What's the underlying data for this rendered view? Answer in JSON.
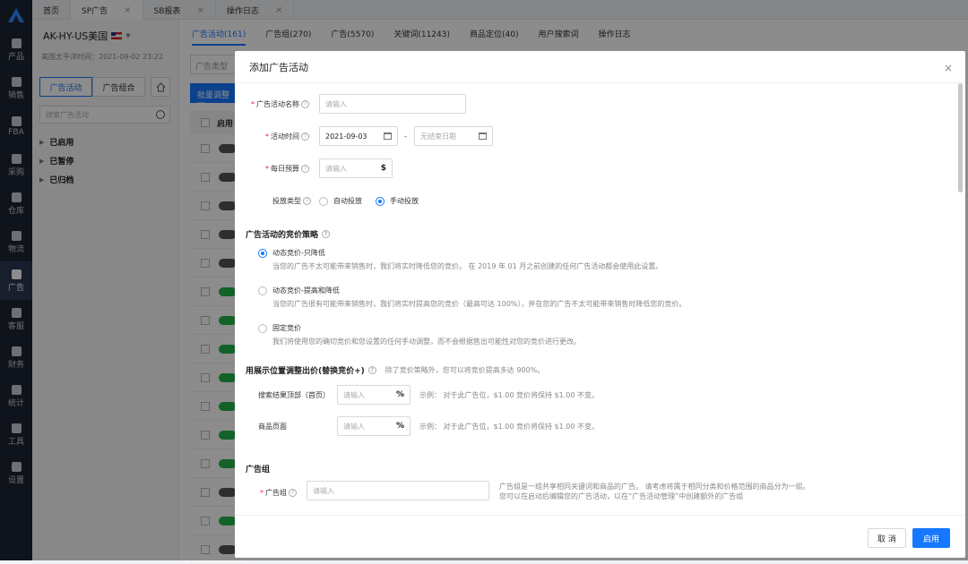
{
  "nav": [
    {
      "label": "产品",
      "icon": "product-icon"
    },
    {
      "label": "销售",
      "icon": "sales-icon"
    },
    {
      "label": "FBA",
      "icon": "fba-icon"
    },
    {
      "label": "采购",
      "icon": "cart-icon"
    },
    {
      "label": "仓库",
      "icon": "warehouse-icon"
    },
    {
      "label": "物流",
      "icon": "truck-icon"
    },
    {
      "label": "广告",
      "icon": "ad-icon"
    },
    {
      "label": "客服",
      "icon": "mail-icon"
    },
    {
      "label": "财务",
      "icon": "finance-icon"
    },
    {
      "label": "统计",
      "icon": "pie-icon"
    },
    {
      "label": "工具",
      "icon": "tool-icon"
    },
    {
      "label": "设置",
      "icon": "gear-icon"
    }
  ],
  "tabs": [
    {
      "label": "首页"
    },
    {
      "label": "SP广告",
      "close": "×"
    },
    {
      "label": "SB报表",
      "close": "×"
    },
    {
      "label": "操作日志",
      "close": "×"
    }
  ],
  "side": {
    "store": "AK-HY-US美国",
    "timezone": "美国太平洋时间：2021-09-02 23:22",
    "seg1": "广告活动",
    "seg2": "广告组合",
    "search_placeholder": "搜索广告活动",
    "tree": [
      "已启用",
      "已暂停",
      "已归档"
    ]
  },
  "main": {
    "tabs": [
      "广告活动(161)",
      "广告组(270)",
      "广告(5570)",
      "关键词(11243)",
      "商品定位(40)",
      "用户搜索词",
      "操作日志"
    ],
    "filter": "广告类型",
    "batch": "批量调整预",
    "col": "启用"
  },
  "modal": {
    "title": "添加广告活动",
    "close": "×",
    "name_label": "广告活动名称",
    "name_placeholder": "请输入",
    "time_label": "活动时间",
    "start_date": "2021-09-03",
    "date_sep": "-",
    "end_placeholder": "无结束日期",
    "budget_label": "每日预算",
    "budget_placeholder": "请输入",
    "budget_suffix": "$",
    "type_label": "投放类型",
    "type_auto": "自动投放",
    "type_manual": "手动投放",
    "bid_section": "广告活动的竞价策略",
    "bid_opts": [
      {
        "title": "动态竞价-只降低",
        "desc": "当您的广告不太可能带来销售时，我们将实时降低您的竞价。 在 2019 年 01 月之前创建的任何广告活动都会使用此设置。",
        "selected": true
      },
      {
        "title": "动态竞价-提高和降低",
        "desc": "当您的广告很有可能带来销售时，我们将实时提高您的竞价（最高可达 100%），并在您的广告不太可能带来销售时降低您的竞价。",
        "selected": false
      },
      {
        "title": "固定竞价",
        "desc": "我们将使用您的确切竞价和您设置的任何手动调整，而不会根据售出可能性对您的竞价进行更改。",
        "selected": false
      }
    ],
    "place_section": "用展示位置调整出价(替换竞价+)",
    "place_hint": "除了竞价策略外，您可以将竞价提高多达 900%。",
    "place_rows": [
      {
        "label": "搜索结果顶部（首页）",
        "placeholder": "请输入",
        "suffix": "%",
        "example": "示例： 对于此广告位，$1.00 竞价将保持 $1.00 不变。"
      },
      {
        "label": "商品页面",
        "placeholder": "请输入",
        "suffix": "%",
        "example": "示例： 对于此广告位，$1.00 竞价将保持 $1.00 不变。"
      }
    ],
    "group_section": "广告组",
    "group_label": "广告组",
    "group_placeholder": "请输入",
    "group_desc1": "广告组是一组共享相同关键词和商品的广告。 请考虑将属于相同分类和价格范围的商品分为一组。",
    "group_desc2": "您可以在启动后编辑您的广告活动，以在“广告活动管理”中创建额外的广告组",
    "cancel": "取 消",
    "submit": "启用"
  }
}
